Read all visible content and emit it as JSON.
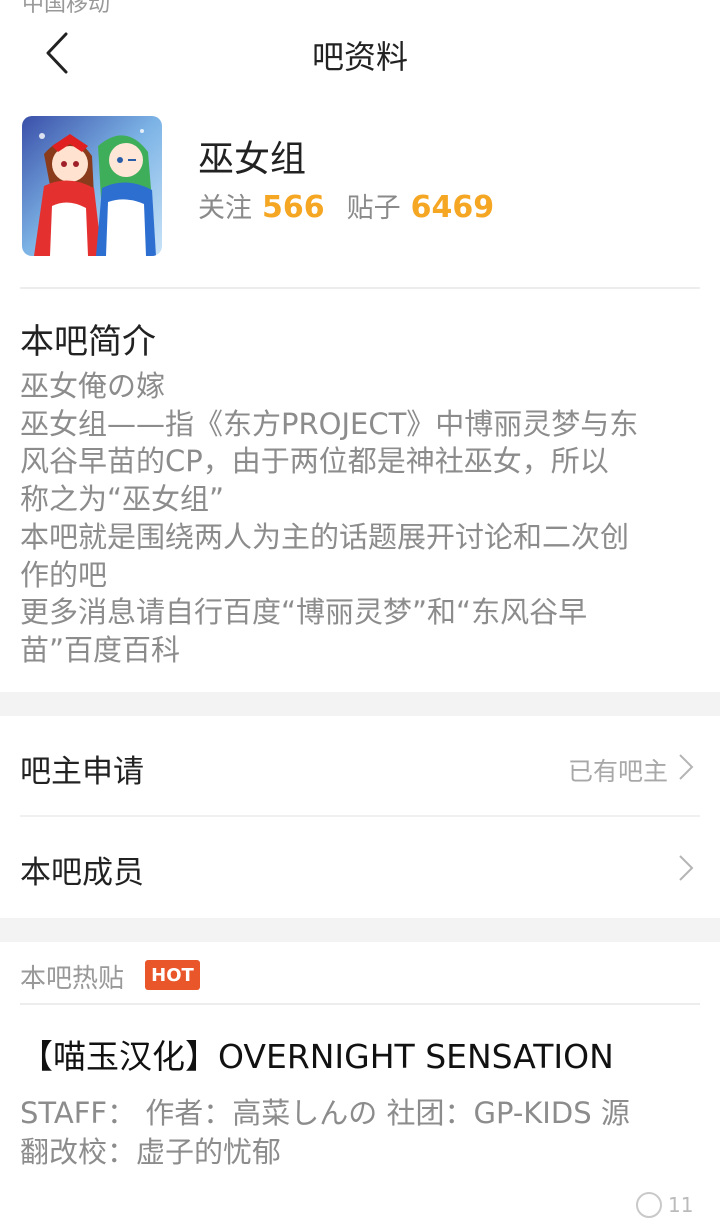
{
  "status": {
    "peek_text": "中国移动"
  },
  "header": {
    "title": "吧资料"
  },
  "forum": {
    "name": "巫女组",
    "follow_label": "关注",
    "follow_count": "566",
    "posts_label": "贴子",
    "posts_count": "6469"
  },
  "intro": {
    "title": "本吧简介",
    "lines": [
      "巫女俺の嫁",
      "巫女组——指《东方PROJECT》中博丽灵梦与东",
      "风谷早苗的CP，由于两位都是神社巫女，所以",
      "称之为“巫女组”",
      "本吧就是围绕两人为主的话题展开讨论和二次创",
      "作的吧",
      "更多消息请自行百度“博丽灵梦”和“东风谷早",
      "苗”百度百科"
    ]
  },
  "rows": {
    "owner_apply": {
      "label": "吧主申请",
      "value": "已有吧主"
    },
    "members": {
      "label": "本吧成员"
    }
  },
  "hot": {
    "header": "本吧热贴",
    "badge": "HOT",
    "post_title": "【喵玉汉化】OVERNIGHT SENSATION",
    "post_excerpt_1": "STAFF： 作者：高菜しんの 社团：GP-KIDS 源",
    "post_excerpt_2": "翻改校：虚子的忧郁",
    "reply_count": "11"
  },
  "colors": {
    "accent": "#f5a623",
    "hot_badge": "#e8562a"
  }
}
